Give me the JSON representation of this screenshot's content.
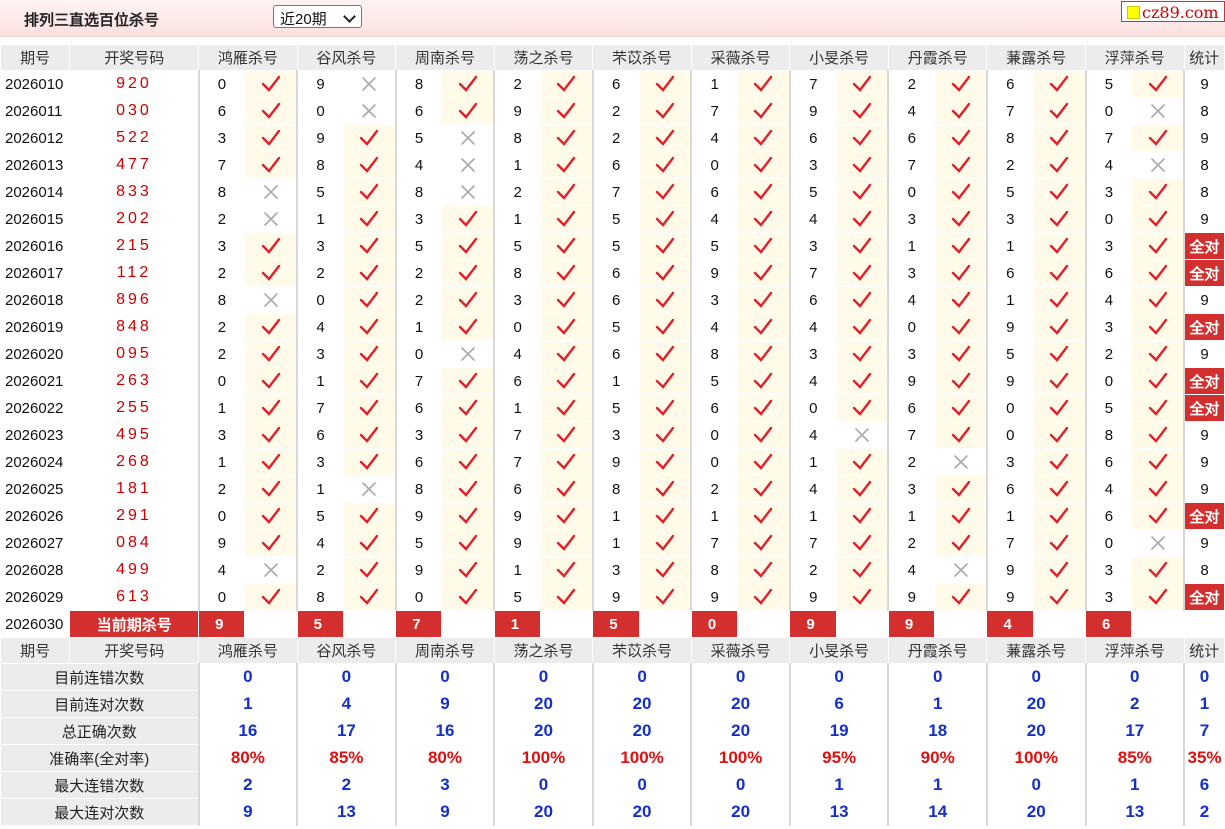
{
  "page_title": "排列三直选百位杀号",
  "period_select": {
    "value": "近20期"
  },
  "logo": "cz89.com",
  "colors": {
    "accent": "#d32f2f",
    "check": "#e0212b",
    "cross": "#aaaaaa",
    "stat_blue": "#1530c8"
  },
  "headers": [
    "期号",
    "开奖号码",
    "鸿雁杀号",
    "谷风杀号",
    "周南杀号",
    "荡之杀号",
    "芣苡杀号",
    "采薇杀号",
    "小旻杀号",
    "丹霞杀号",
    "蒹露杀号",
    "浮萍杀号",
    "统计"
  ],
  "rows": [
    {
      "period": "2026010",
      "open": "920",
      "digits": [
        "0",
        "9",
        "8",
        "2",
        "6",
        "1",
        "7",
        "2",
        "6",
        "5"
      ],
      "marks": [
        "check",
        "cross",
        "check",
        "check",
        "check",
        "check",
        "check",
        "check",
        "check",
        "check"
      ],
      "count": "9"
    },
    {
      "period": "2026011",
      "open": "030",
      "digits": [
        "6",
        "0",
        "6",
        "9",
        "2",
        "7",
        "9",
        "4",
        "7",
        "0"
      ],
      "marks": [
        "check",
        "cross",
        "check",
        "check",
        "check",
        "check",
        "check",
        "check",
        "check",
        "cross"
      ],
      "count": "8"
    },
    {
      "period": "2026012",
      "open": "522",
      "digits": [
        "3",
        "9",
        "5",
        "8",
        "2",
        "4",
        "6",
        "6",
        "8",
        "7"
      ],
      "marks": [
        "check",
        "check",
        "cross",
        "check",
        "check",
        "check",
        "check",
        "check",
        "check",
        "check"
      ],
      "count": "9"
    },
    {
      "period": "2026013",
      "open": "477",
      "digits": [
        "7",
        "8",
        "4",
        "1",
        "6",
        "0",
        "3",
        "7",
        "2",
        "4"
      ],
      "marks": [
        "check",
        "check",
        "cross",
        "check",
        "check",
        "check",
        "check",
        "check",
        "check",
        "cross"
      ],
      "count": "8"
    },
    {
      "period": "2026014",
      "open": "833",
      "digits": [
        "8",
        "5",
        "8",
        "2",
        "7",
        "6",
        "5",
        "0",
        "5",
        "3"
      ],
      "marks": [
        "cross",
        "check",
        "cross",
        "check",
        "check",
        "check",
        "check",
        "check",
        "check",
        "check"
      ],
      "count": "8"
    },
    {
      "period": "2026015",
      "open": "202",
      "digits": [
        "2",
        "1",
        "3",
        "1",
        "5",
        "4",
        "4",
        "3",
        "3",
        "0"
      ],
      "marks": [
        "cross",
        "check",
        "check",
        "check",
        "check",
        "check",
        "check",
        "check",
        "check",
        "check"
      ],
      "count": "9"
    },
    {
      "period": "2026016",
      "open": "215",
      "digits": [
        "3",
        "3",
        "5",
        "5",
        "5",
        "5",
        "3",
        "1",
        "1",
        "3"
      ],
      "marks": [
        "check",
        "check",
        "check",
        "check",
        "check",
        "check",
        "check",
        "check",
        "check",
        "check"
      ],
      "count": "全对"
    },
    {
      "period": "2026017",
      "open": "112",
      "digits": [
        "2",
        "2",
        "2",
        "8",
        "6",
        "9",
        "7",
        "3",
        "6",
        "6"
      ],
      "marks": [
        "check",
        "check",
        "check",
        "check",
        "check",
        "check",
        "check",
        "check",
        "check",
        "check"
      ],
      "count": "全对"
    },
    {
      "period": "2026018",
      "open": "896",
      "digits": [
        "8",
        "0",
        "2",
        "3",
        "6",
        "3",
        "6",
        "4",
        "1",
        "4"
      ],
      "marks": [
        "cross",
        "check",
        "check",
        "check",
        "check",
        "check",
        "check",
        "check",
        "check",
        "check"
      ],
      "count": "9"
    },
    {
      "period": "2026019",
      "open": "848",
      "digits": [
        "2",
        "4",
        "1",
        "0",
        "5",
        "4",
        "4",
        "0",
        "9",
        "3"
      ],
      "marks": [
        "check",
        "check",
        "check",
        "check",
        "check",
        "check",
        "check",
        "check",
        "check",
        "check"
      ],
      "count": "全对"
    },
    {
      "period": "2026020",
      "open": "095",
      "digits": [
        "2",
        "3",
        "0",
        "4",
        "6",
        "8",
        "3",
        "3",
        "5",
        "2"
      ],
      "marks": [
        "check",
        "check",
        "cross",
        "check",
        "check",
        "check",
        "check",
        "check",
        "check",
        "check"
      ],
      "count": "9"
    },
    {
      "period": "2026021",
      "open": "263",
      "digits": [
        "0",
        "1",
        "7",
        "6",
        "1",
        "5",
        "4",
        "9",
        "9",
        "0"
      ],
      "marks": [
        "check",
        "check",
        "check",
        "check",
        "check",
        "check",
        "check",
        "check",
        "check",
        "check"
      ],
      "count": "全对"
    },
    {
      "period": "2026022",
      "open": "255",
      "digits": [
        "1",
        "7",
        "6",
        "1",
        "5",
        "6",
        "0",
        "6",
        "0",
        "5"
      ],
      "marks": [
        "check",
        "check",
        "check",
        "check",
        "check",
        "check",
        "check",
        "check",
        "check",
        "check"
      ],
      "count": "全对"
    },
    {
      "period": "2026023",
      "open": "495",
      "digits": [
        "3",
        "6",
        "3",
        "7",
        "3",
        "0",
        "4",
        "7",
        "0",
        "8"
      ],
      "marks": [
        "check",
        "check",
        "check",
        "check",
        "check",
        "check",
        "cross",
        "check",
        "check",
        "check"
      ],
      "count": "9"
    },
    {
      "period": "2026024",
      "open": "268",
      "digits": [
        "1",
        "3",
        "6",
        "7",
        "9",
        "0",
        "1",
        "2",
        "3",
        "6"
      ],
      "marks": [
        "check",
        "check",
        "check",
        "check",
        "check",
        "check",
        "check",
        "cross",
        "check",
        "check"
      ],
      "count": "9"
    },
    {
      "period": "2026025",
      "open": "181",
      "digits": [
        "2",
        "1",
        "8",
        "6",
        "8",
        "2",
        "4",
        "3",
        "6",
        "4"
      ],
      "marks": [
        "check",
        "cross",
        "check",
        "check",
        "check",
        "check",
        "check",
        "check",
        "check",
        "check"
      ],
      "count": "9"
    },
    {
      "period": "2026026",
      "open": "291",
      "digits": [
        "0",
        "5",
        "9",
        "9",
        "1",
        "1",
        "1",
        "1",
        "1",
        "6"
      ],
      "marks": [
        "check",
        "check",
        "check",
        "check",
        "check",
        "check",
        "check",
        "check",
        "check",
        "check"
      ],
      "count": "全对"
    },
    {
      "period": "2026027",
      "open": "084",
      "digits": [
        "9",
        "4",
        "5",
        "9",
        "1",
        "7",
        "7",
        "2",
        "7",
        "0"
      ],
      "marks": [
        "check",
        "check",
        "check",
        "check",
        "check",
        "check",
        "check",
        "check",
        "check",
        "cross"
      ],
      "count": "9"
    },
    {
      "period": "2026028",
      "open": "499",
      "digits": [
        "4",
        "2",
        "9",
        "1",
        "3",
        "8",
        "2",
        "4",
        "9",
        "3"
      ],
      "marks": [
        "cross",
        "check",
        "check",
        "check",
        "check",
        "check",
        "check",
        "cross",
        "check",
        "check"
      ],
      "count": "8"
    },
    {
      "period": "2026029",
      "open": "613",
      "digits": [
        "0",
        "8",
        "0",
        "5",
        "9",
        "9",
        "9",
        "9",
        "9",
        "3"
      ],
      "marks": [
        "check",
        "check",
        "check",
        "check",
        "check",
        "check",
        "check",
        "check",
        "check",
        "check"
      ],
      "count": "全对"
    }
  ],
  "current": {
    "period": "2026030",
    "label": "当前期杀号",
    "kills": [
      "9",
      "5",
      "7",
      "1",
      "5",
      "0",
      "9",
      "9",
      "4",
      "6"
    ]
  },
  "stats_headers": [
    "期号",
    "开奖号码",
    "鸿雁杀号",
    "谷风杀号",
    "周南杀号",
    "荡之杀号",
    "芣苡杀号",
    "采薇杀号",
    "小旻杀号",
    "丹霞杀号",
    "蒹露杀号",
    "浮萍杀号",
    "统计"
  ],
  "stats": [
    {
      "label": "目前连错次数",
      "values": [
        "0",
        "0",
        "0",
        "0",
        "0",
        "0",
        "0",
        "0",
        "0",
        "0",
        "0"
      ]
    },
    {
      "label": "目前连对次数",
      "values": [
        "1",
        "4",
        "9",
        "20",
        "20",
        "20",
        "6",
        "1",
        "20",
        "2",
        "1"
      ]
    },
    {
      "label": "总正确次数",
      "values": [
        "16",
        "17",
        "16",
        "20",
        "20",
        "20",
        "19",
        "18",
        "20",
        "17",
        "7"
      ]
    },
    {
      "label": "准确率(全对率)",
      "values": [
        "80%",
        "85%",
        "80%",
        "100%",
        "100%",
        "100%",
        "95%",
        "90%",
        "100%",
        "85%",
        "35%"
      ],
      "pct": true
    },
    {
      "label": "最大连错次数",
      "values": [
        "2",
        "2",
        "3",
        "0",
        "0",
        "0",
        "1",
        "1",
        "0",
        "1",
        "6"
      ]
    },
    {
      "label": "最大连对次数",
      "values": [
        "9",
        "13",
        "9",
        "20",
        "20",
        "20",
        "13",
        "14",
        "20",
        "13",
        "2"
      ]
    }
  ]
}
